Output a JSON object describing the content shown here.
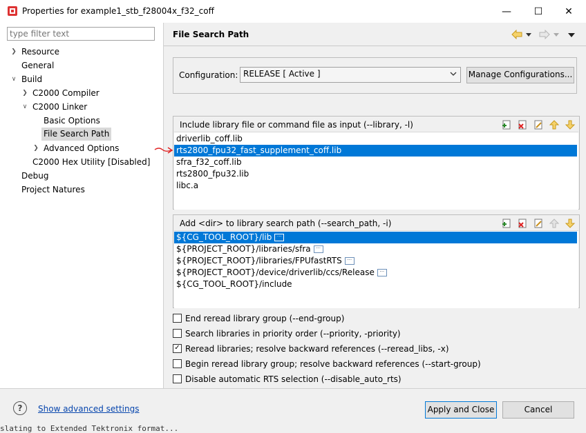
{
  "window": {
    "title": "Properties for example1_stb_f28004x_f32_coff",
    "minimize": "—",
    "maximize": "☐",
    "close": "✕"
  },
  "filter": {
    "placeholder": "type filter text"
  },
  "tree": {
    "resource": "Resource",
    "general": "General",
    "build": "Build",
    "c2000_compiler": "C2000 Compiler",
    "c2000_linker": "C2000 Linker",
    "basic_options": "Basic Options",
    "file_search_path": "File Search Path",
    "advanced_options": "Advanced Options",
    "c2000_hex_utility": "C2000 Hex Utility  [Disabled]",
    "debug": "Debug",
    "project_natures": "Project Natures"
  },
  "page": {
    "title": "File Search Path",
    "configuration_label": "Configuration:",
    "configuration_value": "RELEASE  [ Active ]",
    "manage_button": "Manage Configurations..."
  },
  "library_group": {
    "label": "Include library file or command file as input (--library, -l)",
    "items": [
      "driverlib_coff.lib",
      "rts2800_fpu32_fast_supplement_coff.lib",
      "sfra_f32_coff.lib",
      "rts2800_fpu32.lib",
      "libc.a"
    ]
  },
  "search_group": {
    "label": "Add <dir> to library search path (--search_path, -i)",
    "items": [
      "${CG_TOOL_ROOT}/lib",
      "${PROJECT_ROOT}/libraries/sfra",
      "${PROJECT_ROOT}/libraries/FPUfastRTS",
      "${PROJECT_ROOT}/device/driverlib/ccs/Release",
      "${CG_TOOL_ROOT}/include"
    ]
  },
  "checkboxes": {
    "end_reread": {
      "label": "End reread library group (--end-group)",
      "checked": false
    },
    "priority": {
      "label": "Search libraries in priority order (--priority, -priority)",
      "checked": false
    },
    "reread_libs": {
      "label": "Reread libraries; resolve backward references (--reread_libs, -x)",
      "checked": true
    },
    "begin_reread": {
      "label": "Begin reread library group; resolve backward references (--start-group)",
      "checked": false
    },
    "disable_rts": {
      "label": "Disable automatic RTS selection (--disable_auto_rts)",
      "checked": false
    }
  },
  "footer": {
    "help": "?",
    "advanced_link": "Show advanced settings",
    "apply_close": "Apply and Close",
    "cancel": "Cancel"
  },
  "background_text": "slating to Extended Tektronix format...",
  "colors": {
    "selection": "#0078d7",
    "annotation_arrow": "#e02020"
  }
}
